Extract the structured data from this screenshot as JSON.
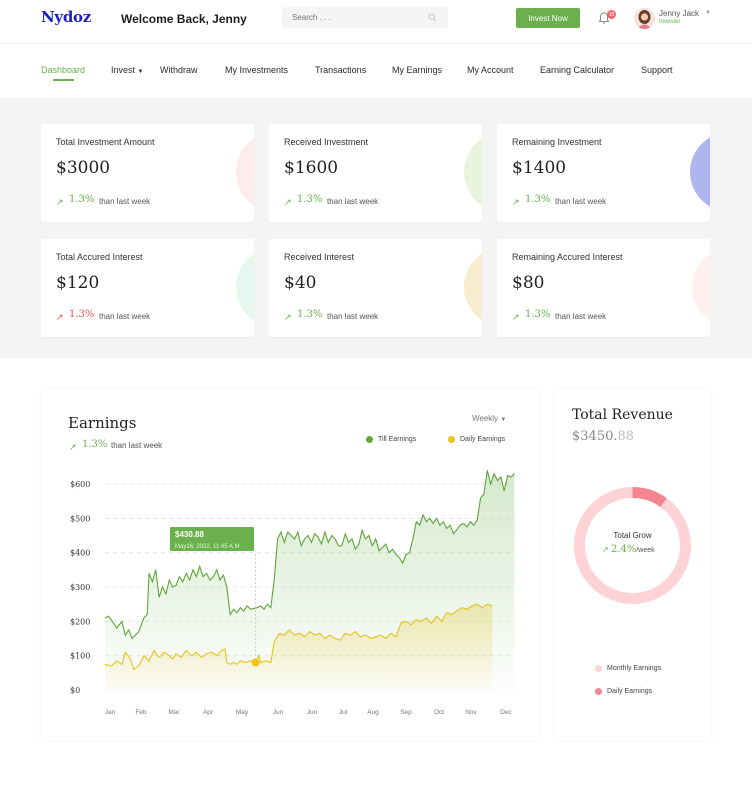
{
  "header": {
    "logo": "Nydoz",
    "welcome": "Welcome Back,  Jenny",
    "search_placeholder": "Search . . .",
    "invest_button": "Invest Now",
    "notification_count": "10",
    "user_name": "Jenny Jack",
    "user_role": "Invester"
  },
  "nav": {
    "items": [
      "Dashboard",
      "Invest",
      "Withdraw",
      "My Investments",
      "Transactions",
      "My Earnings",
      "My Account",
      "Earning Calculator",
      "Support"
    ],
    "active": "Dashboard"
  },
  "stats": [
    {
      "title": "Total Investment Amount",
      "value": "$3000",
      "pct": "1.3%",
      "sub": "than last week",
      "trend": "up",
      "accent": "#fdeceb"
    },
    {
      "title": "Received Investment",
      "value": "$1600",
      "pct": "1.3%",
      "sub": "than last week",
      "trend": "up",
      "accent": "#e9f4dd"
    },
    {
      "title": "Remaining Investment",
      "value": "$1400",
      "pct": "1.3%",
      "sub": "than last week",
      "trend": "up",
      "accent": "#aeb6f0"
    },
    {
      "title": "Total Accured Interest",
      "value": "$120",
      "pct": "1.3%",
      "sub": "than last week",
      "trend": "down",
      "accent": "#e4f8ee"
    },
    {
      "title": "Received Interest",
      "value": "$40",
      "pct": "1.3%",
      "sub": "than last week",
      "trend": "up",
      "accent": "#f8edcf"
    },
    {
      "title": "Remaining Accured Interest",
      "value": "$80",
      "pct": "1.3%",
      "sub": "than last week",
      "trend": "up",
      "accent": "#fdf0ef"
    }
  ],
  "earnings": {
    "title": "Earnings",
    "pct": "1.3%",
    "sub": "than last week",
    "period": "Weekly",
    "tooltip_value": "$430.88",
    "tooltip_date": "May16, 2022, 11:45 A.M"
  },
  "chart_data": {
    "type": "area",
    "x": [
      "Jan",
      "Feb",
      "Mar",
      "Apr",
      "May",
      "Jun",
      "Jun",
      "Jul",
      "Aug",
      "Sep",
      "Oct",
      "Nov",
      "Dec"
    ],
    "ylim": [
      0,
      600
    ],
    "yticks": [
      "$600",
      "$500",
      "$400",
      "$300",
      "$200",
      "$100",
      "$0"
    ],
    "series": [
      {
        "name": "Till Earnings",
        "color": "#5ea53a",
        "points": [
          [
            0,
            210
          ],
          [
            0.1,
            215
          ],
          [
            0.25,
            195
          ],
          [
            0.35,
            180
          ],
          [
            0.5,
            200
          ],
          [
            0.6,
            160
          ],
          [
            0.7,
            175
          ],
          [
            0.8,
            150
          ],
          [
            1,
            170
          ],
          [
            1.15,
            210
          ],
          [
            1.25,
            220
          ],
          [
            1.3,
            340
          ],
          [
            1.4,
            315
          ],
          [
            1.5,
            350
          ],
          [
            1.6,
            270
          ],
          [
            1.7,
            300
          ],
          [
            1.8,
            280
          ],
          [
            1.9,
            320
          ],
          [
            2,
            300
          ],
          [
            2.1,
            305
          ],
          [
            2.2,
            330
          ],
          [
            2.3,
            315
          ],
          [
            2.4,
            340
          ],
          [
            2.5,
            320
          ],
          [
            2.6,
            350
          ],
          [
            2.7,
            330
          ],
          [
            2.8,
            360
          ],
          [
            2.9,
            330
          ],
          [
            3,
            340
          ],
          [
            3.1,
            320
          ],
          [
            3.2,
            330
          ],
          [
            3.3,
            350
          ],
          [
            3.4,
            320
          ],
          [
            3.5,
            335
          ],
          [
            3.6,
            300
          ],
          [
            3.7,
            220
          ],
          [
            3.8,
            235
          ],
          [
            3.9,
            225
          ],
          [
            4,
            240
          ],
          [
            4.1,
            230
          ],
          [
            4.2,
            245
          ],
          [
            4.3,
            235
          ],
          [
            4.5,
            240
          ],
          [
            4.6,
            245
          ],
          [
            4.7,
            235
          ],
          [
            4.8,
            250
          ],
          [
            4.9,
            240
          ],
          [
            5,
            320
          ],
          [
            5.1,
            440
          ],
          [
            5.2,
            460
          ],
          [
            5.3,
            430
          ],
          [
            5.4,
            460
          ],
          [
            5.5,
            450
          ],
          [
            5.6,
            440
          ],
          [
            5.7,
            460
          ],
          [
            5.8,
            420
          ],
          [
            5.9,
            440
          ],
          [
            6,
            450
          ],
          [
            6.1,
            430
          ],
          [
            6.2,
            455
          ],
          [
            6.3,
            445
          ],
          [
            6.4,
            425
          ],
          [
            6.5,
            460
          ],
          [
            6.6,
            430
          ],
          [
            6.7,
            450
          ],
          [
            6.8,
            440
          ],
          [
            6.9,
            420
          ],
          [
            7,
            420
          ],
          [
            7.1,
            455
          ],
          [
            7.2,
            430
          ],
          [
            7.3,
            440
          ],
          [
            7.4,
            410
          ],
          [
            7.5,
            425
          ],
          [
            7.6,
            465
          ],
          [
            7.7,
            440
          ],
          [
            7.8,
            450
          ],
          [
            7.9,
            420
          ],
          [
            8,
            440
          ],
          [
            8.1,
            405
          ],
          [
            8.2,
            415
          ],
          [
            8.3,
            425
          ],
          [
            8.4,
            400
          ],
          [
            8.5,
            410
          ],
          [
            8.6,
            395
          ],
          [
            8.7,
            385
          ],
          [
            8.8,
            370
          ],
          [
            8.9,
            395
          ],
          [
            9,
            400
          ],
          [
            9.1,
            440
          ],
          [
            9.2,
            490
          ],
          [
            9.3,
            480
          ],
          [
            9.4,
            510
          ],
          [
            9.5,
            490
          ],
          [
            9.6,
            500
          ],
          [
            9.7,
            485
          ],
          [
            9.8,
            500
          ],
          [
            9.9,
            480
          ],
          [
            10,
            490
          ],
          [
            10.1,
            470
          ],
          [
            10.2,
            480
          ],
          [
            10.3,
            455
          ],
          [
            10.5,
            480
          ],
          [
            10.6,
            485
          ],
          [
            10.7,
            475
          ],
          [
            10.8,
            490
          ],
          [
            10.9,
            480
          ],
          [
            11,
            495
          ],
          [
            11.1,
            560
          ],
          [
            11.2,
            570
          ],
          [
            11.3,
            640
          ],
          [
            11.4,
            600
          ],
          [
            11.5,
            630
          ],
          [
            11.6,
            610
          ],
          [
            11.7,
            620
          ],
          [
            11.8,
            580
          ],
          [
            11.9,
            625
          ],
          [
            12,
            620
          ],
          [
            12.1,
            630
          ]
        ]
      },
      {
        "name": "Daily Earnings",
        "color": "#f0c419",
        "points": [
          [
            0,
            75
          ],
          [
            0.2,
            70
          ],
          [
            0.35,
            85
          ],
          [
            0.5,
            75
          ],
          [
            0.6,
            110
          ],
          [
            0.75,
            90
          ],
          [
            0.85,
            60
          ],
          [
            1,
            70
          ],
          [
            1.15,
            100
          ],
          [
            1.3,
            85
          ],
          [
            1.45,
            115
          ],
          [
            1.6,
            95
          ],
          [
            1.75,
            110
          ],
          [
            1.9,
            100
          ],
          [
            2,
            90
          ],
          [
            2.1,
            105
          ],
          [
            2.25,
            95
          ],
          [
            2.4,
            115
          ],
          [
            2.55,
            100
          ],
          [
            2.7,
            110
          ],
          [
            2.85,
            95
          ],
          [
            3,
            105
          ],
          [
            3.15,
            110
          ],
          [
            3.3,
            100
          ],
          [
            3.45,
            115
          ],
          [
            3.55,
            120
          ],
          [
            3.6,
            80
          ],
          [
            3.7,
            75
          ],
          [
            3.8,
            80
          ],
          [
            3.9,
            75
          ],
          [
            4,
            85
          ],
          [
            4.15,
            80
          ],
          [
            4.3,
            85
          ],
          [
            4.45,
            80
          ],
          [
            4.55,
            100
          ],
          [
            4.6,
            80
          ],
          [
            4.75,
            85
          ],
          [
            4.9,
            80
          ],
          [
            5,
            140
          ],
          [
            5.15,
            165
          ],
          [
            5.3,
            160
          ],
          [
            5.45,
            175
          ],
          [
            5.6,
            160
          ],
          [
            5.75,
            165
          ],
          [
            5.9,
            155
          ],
          [
            6.05,
            170
          ],
          [
            6.2,
            160
          ],
          [
            6.35,
            165
          ],
          [
            6.5,
            150
          ],
          [
            6.65,
            160
          ],
          [
            6.8,
            150
          ],
          [
            6.95,
            145
          ],
          [
            7.1,
            165
          ],
          [
            7.25,
            160
          ],
          [
            7.4,
            170
          ],
          [
            7.55,
            155
          ],
          [
            7.7,
            160
          ],
          [
            7.85,
            150
          ],
          [
            8,
            155
          ],
          [
            8.15,
            160
          ],
          [
            8.3,
            150
          ],
          [
            8.45,
            165
          ],
          [
            8.6,
            155
          ],
          [
            8.75,
            195
          ],
          [
            8.9,
            200
          ],
          [
            9.05,
            190
          ],
          [
            9.2,
            205
          ],
          [
            9.35,
            200
          ],
          [
            9.5,
            210
          ],
          [
            9.65,
            195
          ],
          [
            9.8,
            215
          ],
          [
            9.95,
            200
          ],
          [
            10.1,
            225
          ],
          [
            10.25,
            220
          ],
          [
            10.4,
            230
          ],
          [
            10.55,
            240
          ],
          [
            10.7,
            235
          ],
          [
            10.85,
            245
          ],
          [
            11,
            250
          ],
          [
            11.15,
            240
          ],
          [
            11.3,
            250
          ],
          [
            11.45,
            245
          ]
        ]
      }
    ]
  },
  "revenue": {
    "title": "Total Revenue",
    "value_main": "$3450.",
    "value_decimal": "88",
    "center_label": "Total Grow",
    "center_pct": "2.4%",
    "center_unit": "/week",
    "donut": [
      {
        "name": "Monthly Earnings",
        "value": 90,
        "color": "#fdd3d6"
      },
      {
        "name": "Daily Earnings",
        "value": 10,
        "color": "#f58591"
      }
    ]
  },
  "colors": {
    "accent": "#6ab04c",
    "brand": "#1b1fbf",
    "down": "#e05555"
  }
}
